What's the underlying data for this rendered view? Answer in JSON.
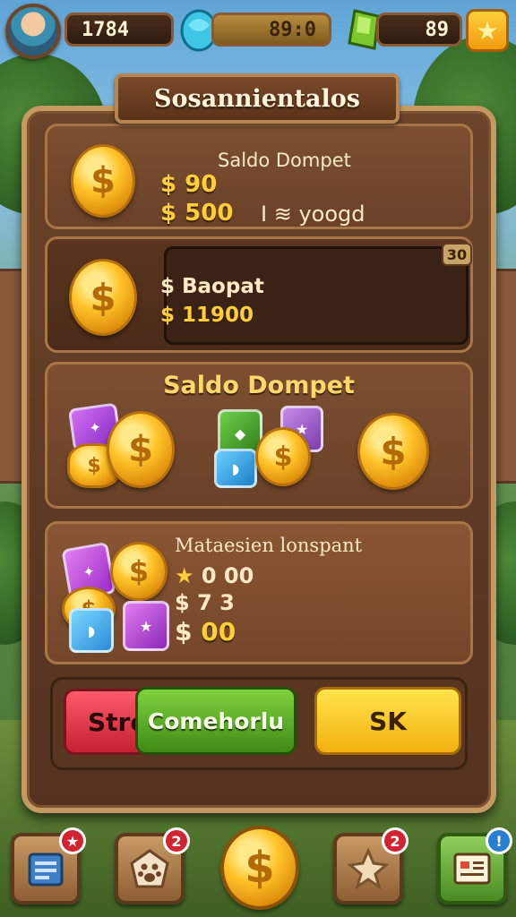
{
  "hud": {
    "left_value": "1784",
    "middle_value": "89:0",
    "right_value": "89"
  },
  "title": "Sosannientalos",
  "card1": {
    "heading": "Saldo Dompet",
    "line1": "$ 90",
    "line2_amount": "$ 500",
    "line2_note": "I ≋ yoogd"
  },
  "card2": {
    "label": "$ Baopat",
    "amount": "$ 11900",
    "badge": "30"
  },
  "card3": {
    "heading": "Saldo Dompet"
  },
  "card4": {
    "heading": "Mataesien lonspant",
    "line1": "0 00",
    "line2": "7 3",
    "line3": "00"
  },
  "buttons": {
    "red": "Stre",
    "green": "Comehorlu",
    "yellow": "SK"
  },
  "nav": {
    "badge_a": "2",
    "badge_b": "2"
  },
  "icons": {
    "hud_gem": "blue-gem-icon",
    "hud_green": "green-gem-icon",
    "star": "star-icon",
    "coin": "dollar-coin-icon"
  },
  "colors": {
    "panel": "#6a4329",
    "gold": "#ffcf3a",
    "red_button": "#e23444",
    "green_button": "#5caf24",
    "yellow_button": "#f8c81e"
  }
}
